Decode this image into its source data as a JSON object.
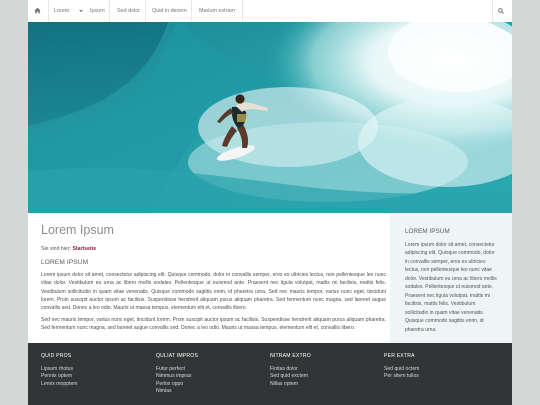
{
  "nav": {
    "items": [
      "Lorem",
      "Ipsum",
      "Sed dolor",
      "Quid in decem",
      "Marium extram"
    ]
  },
  "main": {
    "title": "Lorem Ipsum",
    "breadcrumb_prefix": "Sie sind hier:",
    "breadcrumb_current": "Startseite",
    "heading": "LOREM IPSUM",
    "paragraph1": "Lorem ipsum dolor sit amet, consectetur adipiscing elit. Quisque commodo, dolor in convallis semper, eros ex ultricies lectus, non pellentesque leo nunc vitae dolor. Vestibulum eu urna ac libero mollis sodales. Pellentesque ut euismod ante. Praesent nec ligula volutpat, mattis mi facilisis, mattis felis. Vestibulum sollicitudin in quam vitae venenatis. Quisque commodo sagittis enim, id pharetra urna. Sed nec mauris tempor, varius nunc eget, tincidunt lorem. Proin suscipit auctor ipsum ac facilisis. Suspendisse hendrerit aliquam purus aliquam pharetra. Sed fermentum nunc magna, sed laoreet augue convallis sed. Donec a leo odio. Mauris ut massa tempus, elementum elit et, convallis libero.",
    "paragraph2": "Sed nec mauris tempor, varius nunc eget, tincidunt lorem. Proin suscipit auctor ipsum ac facilisis. Suspendisse hendrerit aliquam purus aliquam pharetra. Sed fermentum nunc magna, sed laoreet augue convallis sed. Donec a leo odio. Mauris ut massa tempus, elementum elit et, convallis libero."
  },
  "aside": {
    "heading": "LOREM IPSUM",
    "text": "Lorem ipsum dolor sit amet, consectetur adipiscing elit. Quisque commodo, dolor in convallis semper, eros ex ultricies lectus, non pellentesque leo nunc vitae dolor. Vestibulum eu urna ac libero mollis sodales. Pellentesque ut euismod ante. Praesent nec ligula volutpat, mattis mi facilisis, mattis felis. Vestibulum sollicitudin in quam vitae venenatis. Quisque commodo sagittis enim, id pharetra urna."
  },
  "footer": {
    "columns": [
      {
        "title": "QUID PROS",
        "links": [
          "Lipsum rhotus",
          "Pennix optem",
          "Lernix mopptem"
        ]
      },
      {
        "title": "QULIAT IMPROS",
        "links": [
          "Futur perfect",
          "Nimmus impras",
          "Perlox oppo",
          "Nimias"
        ]
      },
      {
        "title": "NITRAM EXTRO",
        "links": [
          "Finitas dolor",
          "Sed quid exctem",
          "Nillas optem"
        ]
      },
      {
        "title": "PER EXTRA",
        "links": [
          "Sed quid octem",
          "Per sitem tullos"
        ]
      }
    ]
  },
  "colors": {
    "page_bg": "#d3d7d6",
    "footer_bg": "#323536",
    "aside_bg": "#eef6f5",
    "breadcrumb_link": "#8b1f3a",
    "ocean": "#1f8e9b"
  },
  "icons": {
    "home": "home-icon",
    "search": "search-icon",
    "dropdown": "chevron-down-icon"
  }
}
